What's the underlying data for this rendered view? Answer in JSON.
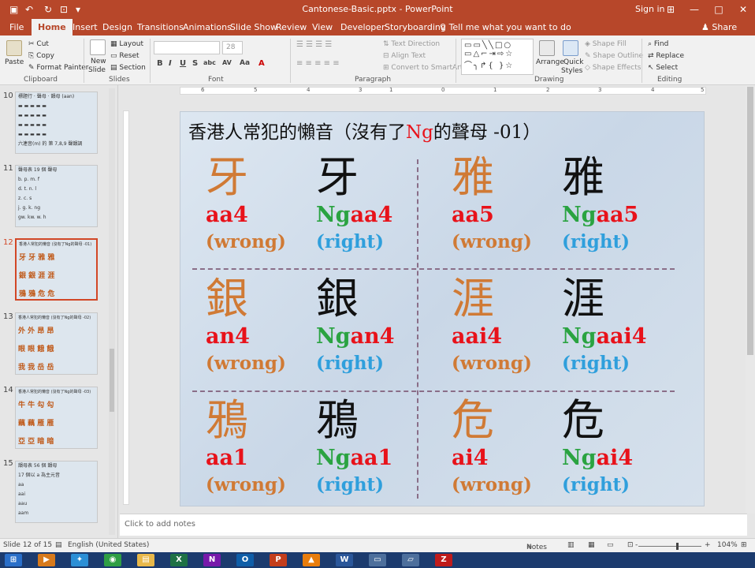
{
  "window": {
    "title": "Cantonese-Basic.pptx - PowerPoint",
    "signin": "Sign in",
    "qa_icons": [
      "save-icon",
      "undo-icon",
      "redo-icon",
      "start-from-beginning-icon",
      "customize-icon"
    ],
    "window_icons": [
      "ribbon-display-icon",
      "minimize-icon",
      "restore-icon",
      "close-icon"
    ]
  },
  "tabs": {
    "items": [
      "File",
      "Home",
      "Insert",
      "Design",
      "Transitions",
      "Animations",
      "Slide Show",
      "Review",
      "View",
      "Developer",
      "Storyboarding"
    ],
    "active": "Home",
    "tell_me": "Tell me what you want to do",
    "share": "Share"
  },
  "ribbon": {
    "clipboard": {
      "label": "Clipboard",
      "paste": "Paste",
      "cut": "Cut",
      "copy": "Copy",
      "format_painter": "Format Painter"
    },
    "slides": {
      "label": "Slides",
      "new_slide": "New",
      "new_slide2": "Slide",
      "layout": "Layout",
      "reset": "Reset",
      "section": "Section"
    },
    "font": {
      "label": "Font",
      "size": "28",
      "bold": "B",
      "italic": "I",
      "underline": "U",
      "strike": "S",
      "shadow": "abc",
      "spacing": "AV",
      "case": "Aa",
      "color": "A"
    },
    "paragraph": {
      "label": "Paragraph",
      "text_direction": "Text Direction",
      "align_text": "Align Text",
      "convert_smartart": "Convert to SmartArt"
    },
    "drawing": {
      "label": "Drawing",
      "arrange": "Arrange",
      "quick_styles": "Quick",
      "quick_styles2": "Styles",
      "shape_fill": "Shape Fill",
      "shape_outline": "Shape Outline",
      "shape_effects": "Shape Effects"
    },
    "editing": {
      "label": "Editing",
      "find": "Find",
      "replace": "Replace",
      "select": "Select"
    }
  },
  "ruler": [
    "6",
    "5",
    "4",
    "3",
    "2",
    "1",
    "0",
    "1",
    "2",
    "3",
    "4",
    "5",
    "6"
  ],
  "thumbnails": [
    {
      "num": "10",
      "text": [
        "標題行 · 聲母 · 韻母 (aan)",
        "▬ ▬ ▬ ▬ ▬",
        "▬ ▬ ▬ ▬ ▬",
        "▬ ▬ ▬ ▬ ▬",
        "▬ ▬ ▬ ▬ ▬",
        "",
        "六連音(m) 的 第 7,8,9 聲韻調"
      ]
    },
    {
      "num": "11",
      "text": [
        "聲母表 19 個 聲母",
        "b.      p.      m.   f",
        "d.      t.      n.    l",
        "z.       c.      s",
        "j.      g.      k.    ng",
        "gw.    kw.    w.    h"
      ]
    },
    {
      "num": "12",
      "text": [
        "香港人常犯的懶音 (沒有了Ng的聲母 -01)",
        "牙  牙   雅  雅",
        "銀  銀   涯  涯",
        "鴉  鴉   危  危"
      ]
    },
    {
      "num": "13",
      "text": [
        "香港人常犯的懶音 (沒有了Ng的聲母 -02)",
        "外  外   昂  昂",
        "眼  眼   餓  餓",
        "我  我   岳  岳"
      ]
    },
    {
      "num": "14",
      "text": [
        "香港人常犯的懶音 (沒有了Ng的聲母 -03)",
        "牛  牛   勾  勾",
        "藕  藕   雁  雁",
        "亞  亞   暗  暗"
      ]
    },
    {
      "num": "15",
      "text": [
        "韻母表 56 個 韻母",
        "17 個以 a 為主元音",
        "aa",
        "aai",
        "aau",
        "aam"
      ]
    }
  ],
  "slide": {
    "title_pre": "香港人常犯的懶音（沒有了",
    "title_ng": "Ng",
    "title_post": "的聲母 -01）",
    "cells": [
      {
        "char": "牙",
        "prefix": "",
        "rom": "aa4",
        "label": "(wrong)",
        "kind": "wrong"
      },
      {
        "char": "牙",
        "prefix": "Ng",
        "rom": "aa4",
        "label": "(right)",
        "kind": "right"
      },
      {
        "char": "雅",
        "prefix": "",
        "rom": "aa5",
        "label": "(wrong)",
        "kind": "wrong"
      },
      {
        "char": "雅",
        "prefix": "Ng",
        "rom": "aa5",
        "label": "(right)",
        "kind": "right"
      },
      {
        "char": "銀",
        "prefix": "",
        "rom": "an4",
        "label": "(wrong)",
        "kind": "wrong"
      },
      {
        "char": "銀",
        "prefix": "Ng",
        "rom": "an4",
        "label": "(right)",
        "kind": "right"
      },
      {
        "char": "涯",
        "prefix": "",
        "rom": "aai4",
        "label": "(wrong)",
        "kind": "wrong"
      },
      {
        "char": "涯",
        "prefix": "Ng",
        "rom": "aai4",
        "label": "(right)",
        "kind": "right"
      },
      {
        "char": "鴉",
        "prefix": "",
        "rom": "aa1",
        "label": "(wrong)",
        "kind": "wrong"
      },
      {
        "char": "鴉",
        "prefix": "Ng",
        "rom": "aa1",
        "label": "(right)",
        "kind": "right"
      },
      {
        "char": "危",
        "prefix": "",
        "rom": "ai4",
        "label": "(wrong)",
        "kind": "wrong"
      },
      {
        "char": "危",
        "prefix": "Ng",
        "rom": "ai4",
        "label": "(right)",
        "kind": "right"
      }
    ]
  },
  "notes": {
    "placeholder": "Click to add notes"
  },
  "status": {
    "slide": "Slide 12 of 15",
    "language": "English (United States)",
    "notes": "Notes",
    "zoom": "104%",
    "plus": "+",
    "minus": "-"
  },
  "taskbar": [
    {
      "icon": "start-icon",
      "label": "⊞",
      "color": "#2a6fc9"
    },
    {
      "icon": "media-player-icon",
      "label": "▶",
      "color": "#d77a1c"
    },
    {
      "icon": "bird-icon",
      "label": "✦",
      "color": "#2b8fd6"
    },
    {
      "icon": "chrome-icon",
      "label": "◉",
      "color": "#2f9e44"
    },
    {
      "icon": "folder-icon",
      "label": "▤",
      "color": "#e8b84a"
    },
    {
      "icon": "excel-icon",
      "label": "X",
      "color": "#1e7145"
    },
    {
      "icon": "onenote-icon",
      "label": "N",
      "color": "#7719aa"
    },
    {
      "icon": "outlook-icon",
      "label": "O",
      "color": "#0f5ea8"
    },
    {
      "icon": "powerpoint-icon",
      "label": "P",
      "color": "#c43e1c"
    },
    {
      "icon": "vlc-icon",
      "label": "▲",
      "color": "#e87d0d"
    },
    {
      "icon": "word-icon",
      "label": "W",
      "color": "#2b579a"
    },
    {
      "icon": "window-icon",
      "label": "▭",
      "color": "#4d6f9c"
    },
    {
      "icon": "screen-icon",
      "label": "▱",
      "color": "#4d6f9c"
    },
    {
      "icon": "filezilla-icon",
      "label": "Z",
      "color": "#bf1b1b"
    }
  ]
}
